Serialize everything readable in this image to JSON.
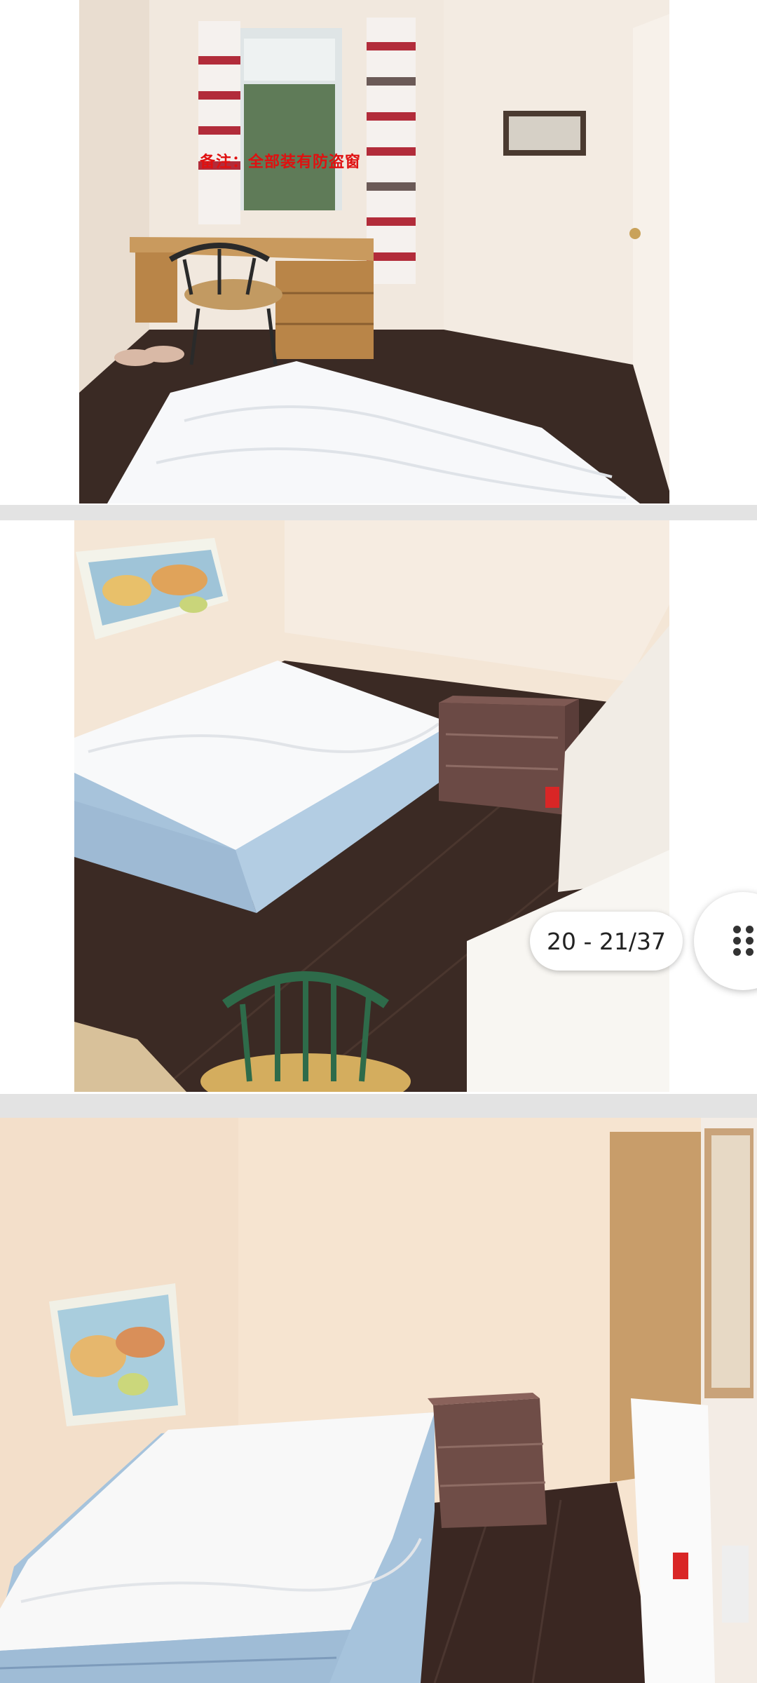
{
  "gallery": {
    "photos": [
      {
        "name": "bedroom-photo-1",
        "caption": "备注：全部装有防盗窗"
      },
      {
        "name": "bedroom-photo-2"
      },
      {
        "name": "bedroom-photo-3"
      }
    ],
    "counter": {
      "label": "20 - 21/37"
    },
    "grid_button": {
      "icon": "grid-dots-icon"
    }
  },
  "colors": {
    "separator": "#e3e3e3",
    "caption_red": "#e01010",
    "wall": "#f4e4d2",
    "floor": "#3a2a24",
    "mattress_blue": "#a9c6de"
  }
}
